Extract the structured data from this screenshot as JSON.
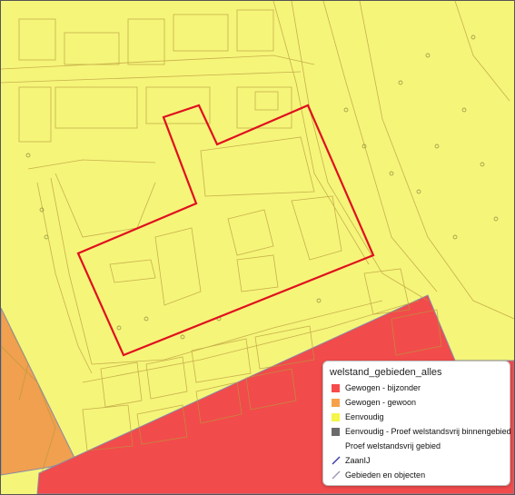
{
  "legend": {
    "title": "welstand_gebieden_alles",
    "items": [
      {
        "label": "Gewogen - bijzonder",
        "color": "#f74a4a",
        "symbol": "square"
      },
      {
        "label": "Gewogen - gewoon",
        "color": "#f7a04a",
        "symbol": "square"
      },
      {
        "label": "Eenvoudig",
        "color": "#f5f54a",
        "symbol": "square"
      },
      {
        "label": "Eenvoudig - Proef welstandsvrij binnengebied",
        "color": "#6b6b6b",
        "symbol": "square"
      },
      {
        "label": "Proef welstandsvrij gebied",
        "color": "",
        "symbol": "none"
      },
      {
        "label": "ZaanIJ",
        "color": "#3a3aa0",
        "symbol": "line"
      },
      {
        "label": "Gebieden en objecten",
        "color": "#9a9ab8",
        "symbol": "line"
      }
    ]
  },
  "map": {
    "colors": {
      "eenvoudig": "#f5f57a",
      "bijzonder": "#f24b4b",
      "gewoon": "#f0a04e",
      "parcel_outline": "#e0101e",
      "lines": "#b89a3a"
    }
  }
}
